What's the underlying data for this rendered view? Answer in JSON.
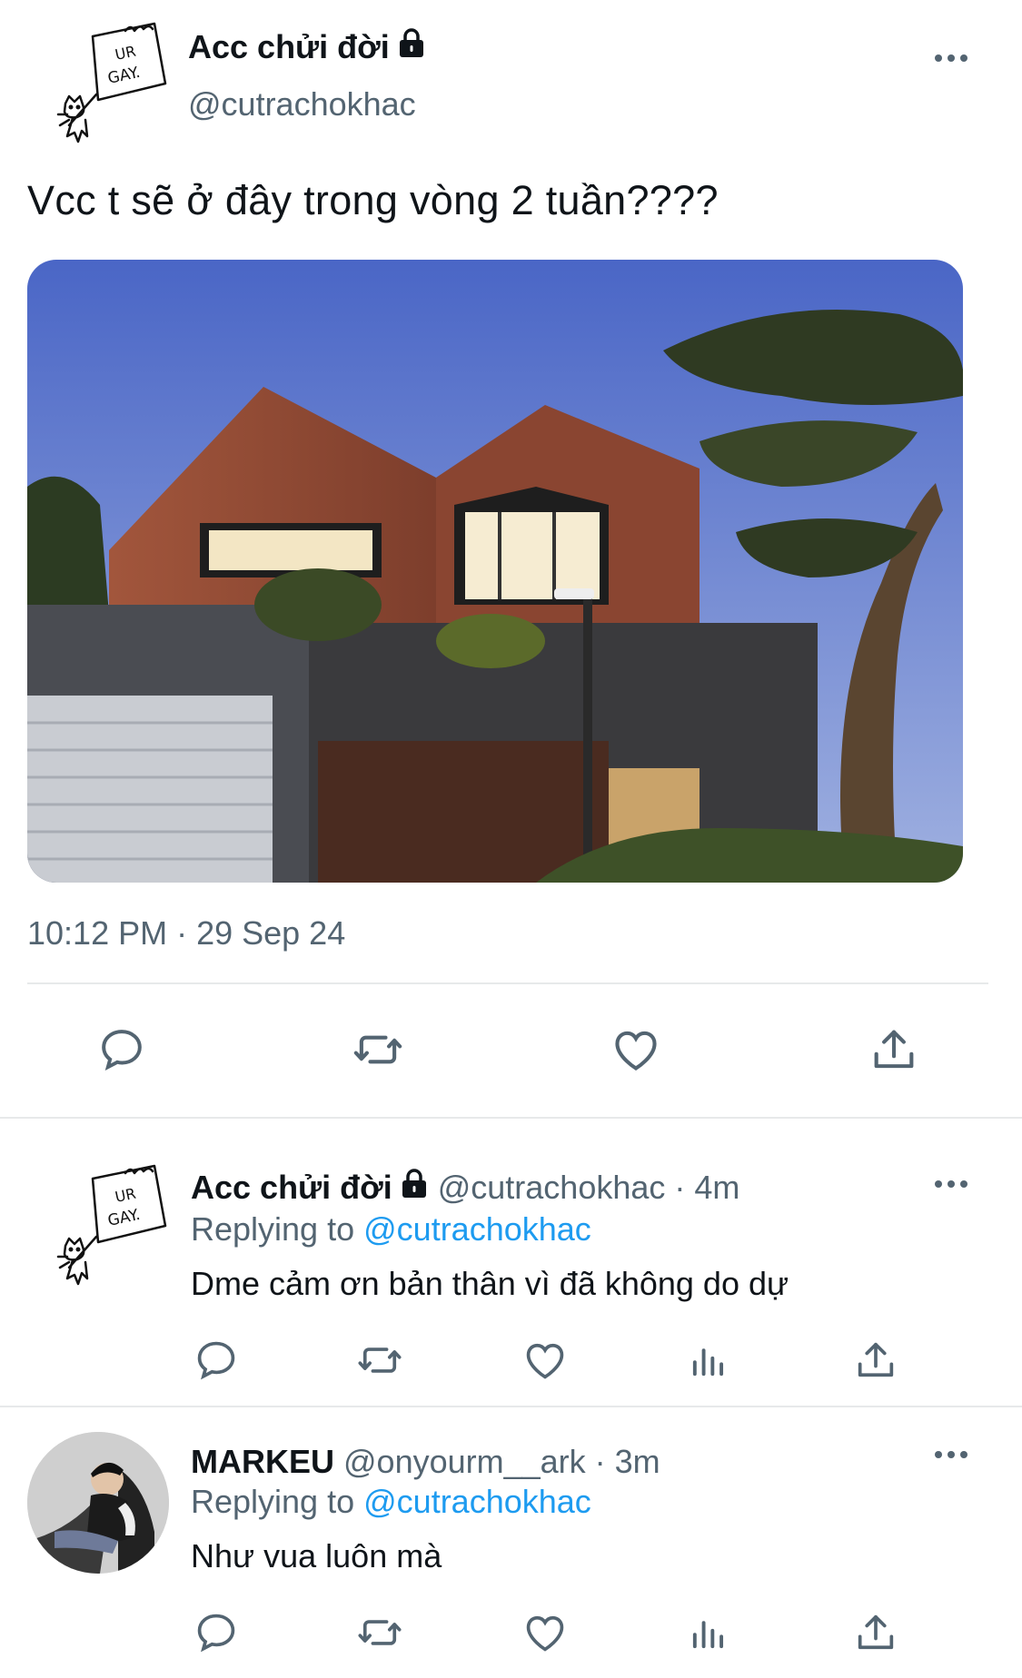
{
  "main_tweet": {
    "display_name": "Acc chửi đời",
    "handle": "@cutrachokhac",
    "text": "Vcc t sẽ ở đây trong vòng 2 tuần????",
    "timestamp": "10:12 PM · 29 Sep 24",
    "avatar_sign_text": [
      "UR",
      "GAY."
    ],
    "actions": [
      "reply-icon",
      "retweet-icon",
      "like-icon",
      "share-icon"
    ]
  },
  "replies": [
    {
      "display_name": "Acc chửi đời",
      "handle": "@cutrachokhac",
      "time": "· 4m",
      "replying_label": "Replying to",
      "replying_to": "@cutrachokhac",
      "text": "Dme cảm ơn bản thân vì đã không do dự",
      "avatar_sign_text": [
        "UR",
        "GAY."
      ]
    },
    {
      "display_name": "MARKEU",
      "handle": "@onyourm__ark",
      "time": "· 3m",
      "replying_label": "Replying to",
      "replying_to": "@cutrachokhac",
      "text": "Như vua luôn mà"
    }
  ],
  "colors": {
    "text": "#0f1419",
    "secondary": "#536471",
    "link": "#1d9bf0",
    "divider": "#e7e9ea"
  }
}
